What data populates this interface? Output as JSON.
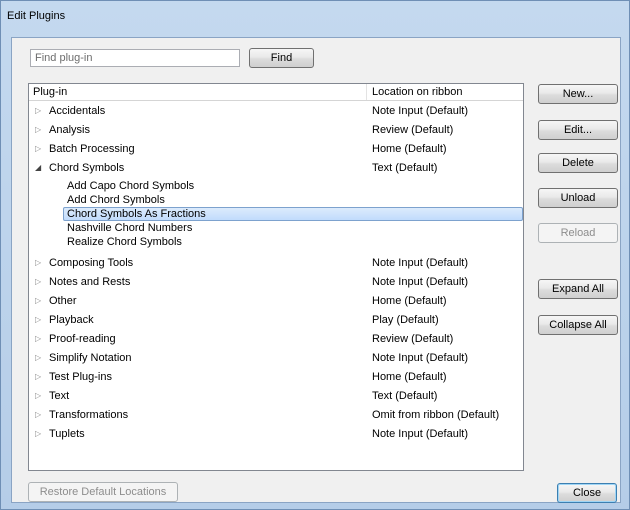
{
  "window": {
    "title": "Edit Plugins"
  },
  "search": {
    "placeholder": "Find plug-in",
    "find_label": "Find"
  },
  "columns": {
    "plugin": "Plug-in",
    "location": "Location on ribbon"
  },
  "plugins": [
    {
      "name": "Accidentals",
      "location": "Note Input (Default)",
      "expanded": false
    },
    {
      "name": "Analysis",
      "location": "Review (Default)",
      "expanded": false
    },
    {
      "name": "Batch Processing",
      "location": "Home (Default)",
      "expanded": false
    },
    {
      "name": "Chord Symbols",
      "location": "Text (Default)",
      "expanded": true,
      "children": [
        "Add Capo Chord Symbols",
        "Add Chord Symbols",
        "Chord Symbols As Fractions",
        "Nashville Chord Numbers",
        "Realize Chord Symbols"
      ],
      "selected_child": "Chord Symbols As Fractions"
    },
    {
      "name": "Composing Tools",
      "location": "Note Input (Default)",
      "expanded": false
    },
    {
      "name": "Notes and Rests",
      "location": "Note Input (Default)",
      "expanded": false
    },
    {
      "name": "Other",
      "location": "Home (Default)",
      "expanded": false
    },
    {
      "name": "Playback",
      "location": "Play (Default)",
      "expanded": false
    },
    {
      "name": "Proof-reading",
      "location": "Review (Default)",
      "expanded": false
    },
    {
      "name": "Simplify Notation",
      "location": "Note Input (Default)",
      "expanded": false
    },
    {
      "name": "Test Plug-ins",
      "location": "Home (Default)",
      "expanded": false
    },
    {
      "name": "Text",
      "location": "Text (Default)",
      "expanded": false
    },
    {
      "name": "Transformations",
      "location": "Omit from ribbon (Default)",
      "expanded": false
    },
    {
      "name": "Tuplets",
      "location": "Note Input (Default)",
      "expanded": false
    }
  ],
  "side_buttons": {
    "new": "New...",
    "edit": "Edit...",
    "delete": "Delete",
    "unload": "Unload",
    "reload": "Reload",
    "expand_all": "Expand All",
    "collapse_all": "Collapse All"
  },
  "footer": {
    "restore": "Restore Default Locations",
    "close": "Close"
  }
}
